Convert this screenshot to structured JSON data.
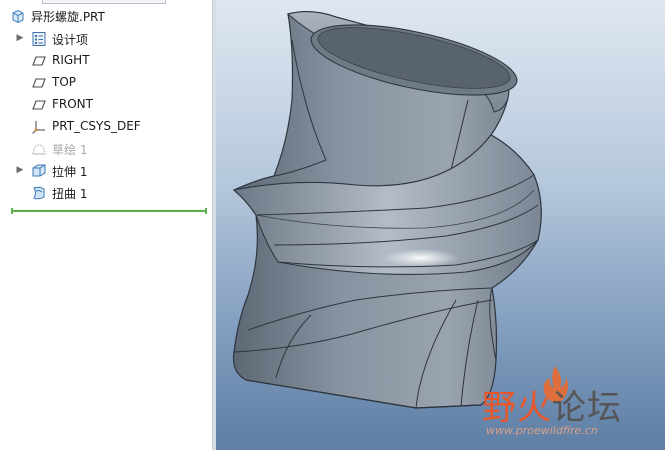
{
  "tree": {
    "items": [
      {
        "label": "异形螺旋.PRT",
        "icon": "part-icon",
        "expander": false
      },
      {
        "label": "设计项",
        "icon": "design-items-icon",
        "expander": true
      },
      {
        "label": "RIGHT",
        "icon": "datum-plane-icon",
        "expander": false
      },
      {
        "label": "TOP",
        "icon": "datum-plane-icon",
        "expander": false
      },
      {
        "label": "FRONT",
        "icon": "datum-plane-icon",
        "expander": false
      },
      {
        "label": "PRT_CSYS_DEF",
        "icon": "csys-icon",
        "expander": false
      },
      {
        "label": "草绘 1",
        "icon": "sketch-icon",
        "expander": false,
        "dimmed": true
      },
      {
        "label": "拉伸 1",
        "icon": "extrude-icon",
        "expander": true
      },
      {
        "label": "扭曲 1",
        "icon": "warp-icon",
        "expander": false
      }
    ]
  },
  "watermark": {
    "title_part1": "野火",
    "title_part2": "论坛",
    "url": "www.proewildfire.cn"
  },
  "colors": {
    "viewport_top": "#dfe7f1",
    "viewport_bottom": "#5e7ea4",
    "model_fill": "#7f8a98",
    "watermark_accent": "#e8562a"
  }
}
